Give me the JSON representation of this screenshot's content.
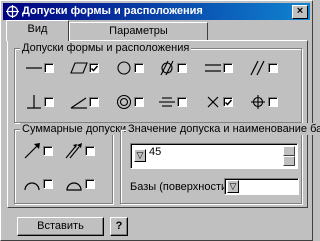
{
  "window": {
    "title": "Допуски формы и расположения",
    "close_label": "×"
  },
  "tabs": [
    {
      "label": "Вид",
      "active": true
    },
    {
      "label": "Параметры",
      "active": false
    }
  ],
  "groups": {
    "form_position": "Допуски формы и расположения",
    "summary": "Суммарные допуски",
    "value": "Значение допуска и наименование баз"
  },
  "tolerances": [
    {
      "icon": "straightness-icon",
      "checked": false
    },
    {
      "icon": "flatness-icon",
      "checked": true
    },
    {
      "icon": "roundness-icon",
      "checked": false
    },
    {
      "icon": "cylindricity-icon",
      "checked": false
    },
    {
      "icon": "parallelism-icon",
      "checked": false
    },
    {
      "icon": "parallelism-slanted-icon",
      "checked": false
    },
    {
      "icon": "perpendicularity-icon",
      "checked": false
    },
    {
      "icon": "angularity-icon",
      "checked": false
    },
    {
      "icon": "concentricity-icon",
      "checked": false
    },
    {
      "icon": "symmetry-icon",
      "checked": false
    },
    {
      "icon": "intersection-icon",
      "checked": true
    },
    {
      "icon": "position-icon",
      "checked": false
    }
  ],
  "summary_tolerances": [
    {
      "icon": "runout-icon",
      "checked": false
    },
    {
      "icon": "total-runout-icon",
      "checked": false
    },
    {
      "icon": "profile-line-icon",
      "checked": false
    },
    {
      "icon": "profile-surface-icon",
      "checked": false
    }
  ],
  "tolerance_value": "45",
  "bases_label": "Базы (поверхности)",
  "bases_value": "",
  "insert_button": "Вставить",
  "help_button": "?"
}
